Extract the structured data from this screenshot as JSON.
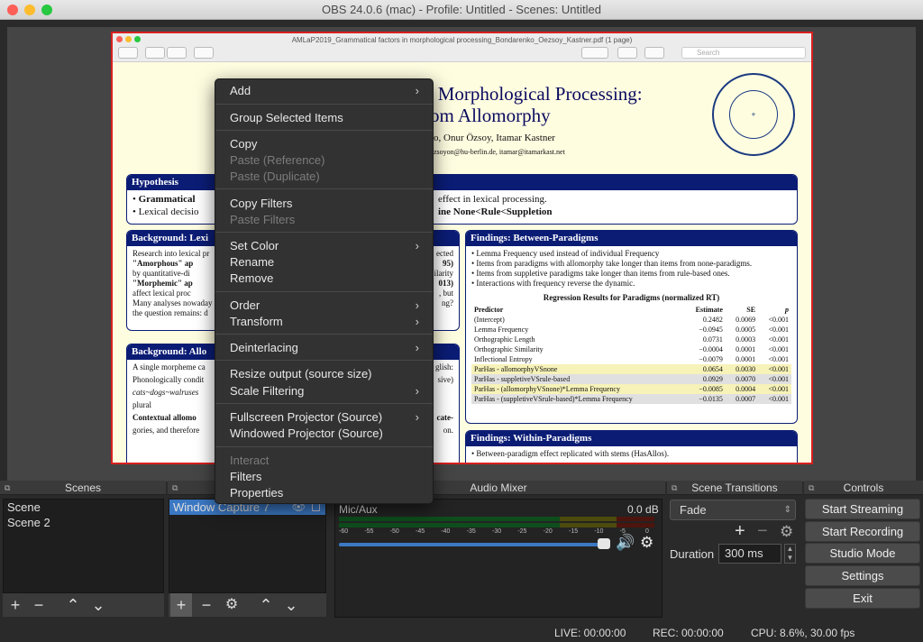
{
  "window": {
    "title": "OBS 24.0.6 (mac) - Profile: Untitled - Scenes: Untitled"
  },
  "pdf": {
    "filename": "AMLaP2019_Grammatical factors in morphological processing_Bondarenko_Oezsoy_Kastner.pdf (1 page)",
    "search_placeholder": "Search",
    "title_line1": "n Morphological Processing:",
    "title_line2": "rom Allomorphy",
    "authors": "o, Onur Özsoy, Itamar Kastner",
    "emails": "zsoyon@hu-berlin.de, itamar@itamarkast.net",
    "seal_outer": "HUMBOLDT-UNIVERSITÄT · ZU BERLIN",
    "hypothesis": {
      "title": "Hypothesis",
      "l1a": "Grammatical",
      "l1b": "effect in lexical processing.",
      "l2a": "Lexical decisio",
      "l2b": "ine None<Rule<Suppletion"
    },
    "bg_lex": {
      "title": "Background: Lexi",
      "lines": [
        "Research into lexical pr",
        "\"Amorphous\" ap",
        "by quantitative-di",
        "\"Morphemic\" ap",
        "affect lexical proc",
        "Many analyses nowaday",
        "the question remains: d"
      ],
      "right": [
        "ected",
        "95)",
        "ilarity",
        "013)",
        ", but",
        "ng?"
      ]
    },
    "bg_allo": {
      "title": "Background: Allo",
      "lines": [
        "A single morpheme ca",
        "Phonologically condit",
        "cats~dogs~walruses",
        "plural",
        "Contextual allomo",
        "gories, and therefore"
      ],
      "right": [
        "glish:",
        "sive)",
        "cate-",
        "on."
      ]
    },
    "between": {
      "title": "Findings: Between-Paradigms",
      "bullets": [
        "Lemma Frequency used instead of individual Frequency",
        "Items from paradigms with allomorphy take longer than items from none-paradigms.",
        "Items from suppletive paradigms take longer than items from rule-based ones.",
        "Interactions with frequency reverse the dynamic."
      ],
      "table_title": "Regression Results for Paradigms (normalized RT)",
      "headers": [
        "Predictor",
        "Estimate",
        "SE",
        "p"
      ],
      "rows": [
        [
          "(Intercept)",
          "0.2482",
          "0.0069",
          "<0.001"
        ],
        [
          "Lemma Frequency",
          "−0.0945",
          "0.0005",
          "<0.001"
        ],
        [
          "Orthographic Length",
          "0.0731",
          "0.0003",
          "<0.001"
        ],
        [
          "Orthographic Similarity",
          "−0.0004",
          "0.0001",
          "<0.001"
        ],
        [
          "Inflectional Entropy",
          "−0.0079",
          "0.0001",
          "<0.001"
        ],
        [
          "ParHas - allomorphyVSnone",
          "0.0654",
          "0.0030",
          "<0.001"
        ],
        [
          "ParHas - suppletiveVSrule-based",
          "0.0929",
          "0.0070",
          "<0.001"
        ],
        [
          "ParHas - (allomorphyVSnone)*Lemma Frequency",
          "−0.0085",
          "0.0004",
          "<0.001"
        ],
        [
          "ParHas - (suppletiveVSrule-based)*Lemma Frequency",
          "−0.0135",
          "0.0007",
          "<0.001"
        ]
      ]
    },
    "within": {
      "title": "Findings: Within-Paradigms",
      "bullet": "Between-paradigm effect replicated with stems (HasAllos)."
    }
  },
  "context_menu": {
    "items": [
      {
        "label": "Add",
        "submenu": true,
        "disabled": false
      },
      {
        "label": "Group Selected Items",
        "submenu": false,
        "disabled": false
      },
      {
        "label": "Copy",
        "submenu": false,
        "disabled": false
      },
      {
        "label": "Paste (Reference)",
        "submenu": false,
        "disabled": true
      },
      {
        "label": "Paste (Duplicate)",
        "submenu": false,
        "disabled": true
      },
      {
        "label": "Copy Filters",
        "submenu": false,
        "disabled": false
      },
      {
        "label": "Paste Filters",
        "submenu": false,
        "disabled": true
      },
      {
        "label": "Set Color",
        "submenu": true,
        "disabled": false
      },
      {
        "label": "Rename",
        "submenu": false,
        "disabled": false
      },
      {
        "label": "Remove",
        "submenu": false,
        "disabled": false
      },
      {
        "label": "Order",
        "submenu": true,
        "disabled": false
      },
      {
        "label": "Transform",
        "submenu": true,
        "disabled": false
      },
      {
        "label": "Deinterlacing",
        "submenu": true,
        "disabled": false
      },
      {
        "label": "Resize output (source size)",
        "submenu": false,
        "disabled": false
      },
      {
        "label": "Scale Filtering",
        "submenu": true,
        "disabled": false
      },
      {
        "label": "Fullscreen Projector (Source)",
        "submenu": true,
        "disabled": false
      },
      {
        "label": "Windowed Projector (Source)",
        "submenu": false,
        "disabled": false
      },
      {
        "label": "Interact",
        "submenu": false,
        "disabled": true
      },
      {
        "label": "Filters",
        "submenu": false,
        "disabled": false
      },
      {
        "label": "Properties",
        "submenu": false,
        "disabled": false
      }
    ],
    "arrow": "›"
  },
  "scenes": {
    "title": "Scenes",
    "items": [
      "Scene",
      "Scene 2"
    ]
  },
  "sources": {
    "items": [
      "Window Capture 7"
    ]
  },
  "audio": {
    "title": "Audio Mixer",
    "channel": "Mic/Aux",
    "level": "0.0 dB",
    "ticks": [
      "-60",
      "-55",
      "-50",
      "-45",
      "-40",
      "-35",
      "-30",
      "-25",
      "-20",
      "-15",
      "-10",
      "-5",
      "0"
    ],
    "volume_fraction": 1.0
  },
  "transitions": {
    "title": "Scene Transitions",
    "selected": "Fade",
    "duration_label": "Duration",
    "duration_value": "300 ms"
  },
  "controls": {
    "title": "Controls",
    "buttons": [
      "Start Streaming",
      "Start Recording",
      "Studio Mode",
      "Settings",
      "Exit"
    ]
  },
  "status": {
    "live": "LIVE: 00:00:00",
    "rec": "REC: 00:00:00",
    "cpu": "CPU: 8.6%, 30.00 fps"
  },
  "colors": {
    "accent": "#3b78c4",
    "selection_border": "#d9201f",
    "poster_blue": "#0b1c75"
  }
}
